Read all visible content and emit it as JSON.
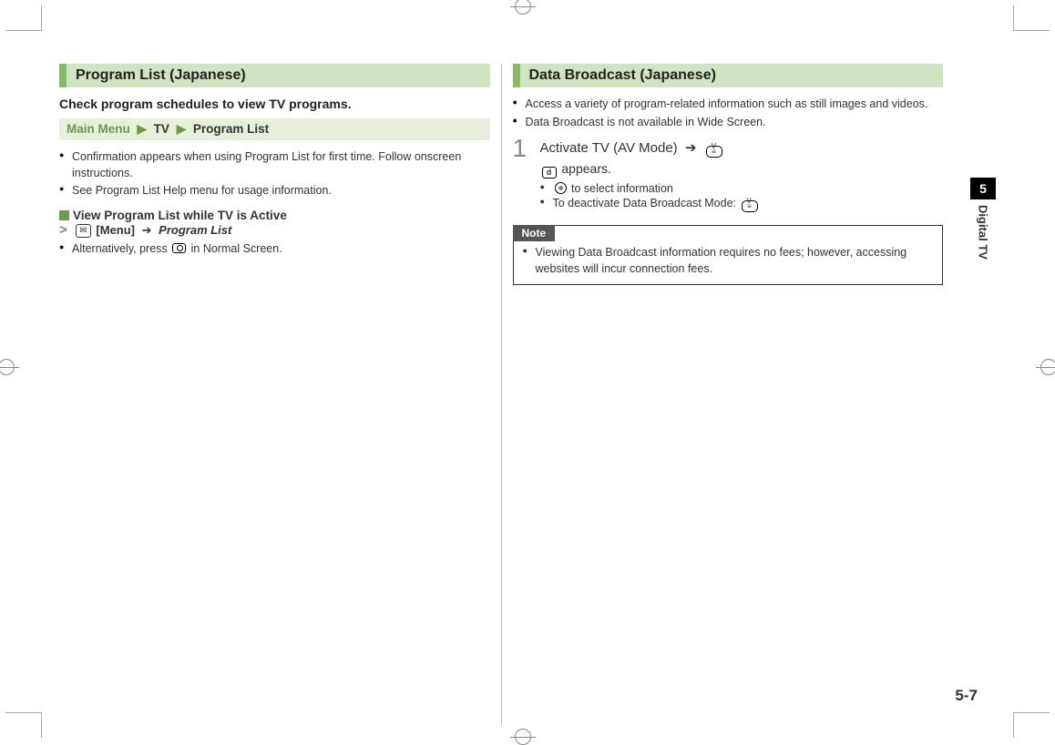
{
  "page_number": "5-7",
  "side_tab": {
    "number": "5",
    "label": "Digital TV"
  },
  "left": {
    "heading": "Program List (Japanese)",
    "subhead": "Check program schedules to view TV programs.",
    "breadcrumb": {
      "main": "Main Menu",
      "l2": "TV",
      "l3": "Program List"
    },
    "bullets": [
      "Confirmation appears when using Program List for first time. Follow onscreen instructions.",
      "See Program List Help menu for usage information."
    ],
    "sub_title": "View Program List while TV is Active",
    "sub_path": {
      "menu": "[Menu]",
      "target": "Program List"
    },
    "alt_prefix": "Alternatively, press",
    "alt_suffix": "in Normal Screen."
  },
  "right": {
    "heading": "Data Broadcast (Japanese)",
    "bullets": [
      "Access a variety of program-related information such as still images and videos.",
      "Data Broadcast is not available in Wide Screen."
    ],
    "step1": {
      "main_prefix": "Activate TV (AV Mode)",
      "appears_suffix": "appears.",
      "select_info": "to select information",
      "deactivate": "To deactivate Data Broadcast Mode:"
    },
    "note_label": "Note",
    "note_text": "Viewing Data Broadcast information requires no fees; however, accessing websites will incur connection fees."
  }
}
